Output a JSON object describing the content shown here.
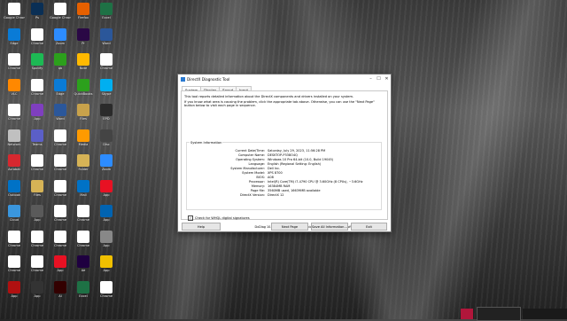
{
  "desktop": {
    "icons": [
      {
        "label": "Google Chrome",
        "color": "#ffffff"
      },
      {
        "label": "Ps",
        "color": "#0a2f55"
      },
      {
        "label": "Google Chrome",
        "color": "#ffffff"
      },
      {
        "label": "Firefox",
        "color": "#e66000"
      },
      {
        "label": "Excel",
        "color": "#1e7145"
      },
      {
        "label": "Edge",
        "color": "#0a7bd6"
      },
      {
        "label": "Chrome",
        "color": "#ffffff"
      },
      {
        "label": "Zoom",
        "color": "#2d8cff"
      },
      {
        "label": "Pr",
        "color": "#2a0845"
      },
      {
        "label": "Word",
        "color": "#2b579a"
      },
      {
        "label": "Chrome",
        "color": "#ffffff"
      },
      {
        "label": "Spotify",
        "color": "#1db954"
      },
      {
        "label": "qb",
        "color": "#2ca01c"
      },
      {
        "label": "Note",
        "color": "#ffb900"
      },
      {
        "label": "Chrome",
        "color": "#ffffff"
      },
      {
        "label": "VLC",
        "color": "#ff8800"
      },
      {
        "label": "Chrome",
        "color": "#ffffff"
      },
      {
        "label": "Edge",
        "color": "#0a7bd6"
      },
      {
        "label": "QuickBooks",
        "color": "#2ca01c"
      },
      {
        "label": "Skype",
        "color": "#00aff0"
      },
      {
        "label": "Chrome",
        "color": "#ffffff"
      },
      {
        "label": "App",
        "color": "#7f3fbf"
      },
      {
        "label": "Word",
        "color": "#2b579a"
      },
      {
        "label": "Files",
        "color": "#c8a24b"
      },
      {
        "label": "EPD",
        "color": "#2b2b2b"
      },
      {
        "label": "Network",
        "color": "#c0c0c0"
      },
      {
        "label": "Teams",
        "color": "#5b5fc7"
      },
      {
        "label": "Chrome",
        "color": "#ffffff"
      },
      {
        "label": "Media",
        "color": "#ff9a00"
      },
      {
        "label": "Disc",
        "color": "#444444"
      },
      {
        "label": "Acrobat",
        "color": "#d7282f"
      },
      {
        "label": "Chrome",
        "color": "#ffffff"
      },
      {
        "label": "Chrome",
        "color": "#ffffff"
      },
      {
        "label": "Folder",
        "color": "#d6b356"
      },
      {
        "label": "Zoom",
        "color": "#2d8cff"
      },
      {
        "label": "Outlook",
        "color": "#0072c6"
      },
      {
        "label": "Files",
        "color": "#d6b356"
      },
      {
        "label": "Chrome",
        "color": "#ffffff"
      },
      {
        "label": "Mail",
        "color": "#0072c6"
      },
      {
        "label": "App",
        "color": "#e81123"
      },
      {
        "label": "Cloud",
        "color": "#3a96dd"
      },
      {
        "label": "App",
        "color": "#5a5a5a"
      },
      {
        "label": "Chrome",
        "color": "#ffffff"
      },
      {
        "label": "Chrome",
        "color": "#ffffff"
      },
      {
        "label": "App",
        "color": "#0063b1"
      },
      {
        "label": "Chrome",
        "color": "#ffffff"
      },
      {
        "label": "Chrome",
        "color": "#ffffff"
      },
      {
        "label": "Chrome",
        "color": "#ffffff"
      },
      {
        "label": "Chrome",
        "color": "#ffffff"
      },
      {
        "label": "App",
        "color": "#888888"
      },
      {
        "label": "Chrome",
        "color": "#ffffff"
      },
      {
        "label": "Chrome",
        "color": "#ffffff"
      },
      {
        "label": "App",
        "color": "#e81123"
      },
      {
        "label": "Ae",
        "color": "#1f0040"
      },
      {
        "label": "App",
        "color": "#f0c000"
      },
      {
        "label": "App",
        "color": "#b01010"
      },
      {
        "label": "App",
        "color": "#333333"
      },
      {
        "label": "Ai",
        "color": "#330000"
      },
      {
        "label": "Excel",
        "color": "#1e7145"
      },
      {
        "label": "Chrome",
        "color": "#ffffff"
      },
      {
        "label": "App",
        "color": "#884488"
      },
      {
        "label": "App",
        "color": "#dddddd"
      }
    ]
  },
  "dialog": {
    "title": "DirectX Diagnostic Tool",
    "minimize": "–",
    "maximize": "☐",
    "close": "✕",
    "tabs": [
      "System",
      "Display",
      "Sound",
      "Input"
    ],
    "intro_1": "This tool reports detailed information about the DirectX components and drivers installed on your system.",
    "intro_2": "If you know what area is causing the problem, click the appropriate tab above. Otherwise, you can use the \"Next Page\" button below to visit each page in sequence.",
    "group_label": "System Information",
    "rows": [
      {
        "k": "Current Date/Time:",
        "v": "Saturday, July 29, 2023, 11:56:28 PM"
      },
      {
        "k": "Computer Name:",
        "v": "DESKTOP-P338O4Q"
      },
      {
        "k": "Operating System:",
        "v": "Windows 10 Pro 64-bit (10.0, Build 19045)"
      },
      {
        "k": "Language:",
        "v": "English (Regional Setting: English)"
      },
      {
        "k": "System Manufacturer:",
        "v": "Dell Inc."
      },
      {
        "k": "System Model:",
        "v": "XPS 8700"
      },
      {
        "k": "BIOS:",
        "v": "A08"
      },
      {
        "k": "Processor:",
        "v": "Intel(R) Core(TM) i7-4790 CPU @ 3.60GHz (8 CPUs), ~3.6GHz"
      },
      {
        "k": "Memory:",
        "v": "16384MB RAM"
      },
      {
        "k": "Page file:",
        "v": "3560MB used, 16639MB available"
      },
      {
        "k": "DirectX Version:",
        "v": "DirectX 12"
      }
    ],
    "whql_label": "Check for WHQL digital signatures",
    "whql_checked": "✓",
    "copyright": "DxDiag 10.00.19041.3570 64-bit Unicode  Copyright © Microsoft. All rights reserved.",
    "buttons": {
      "help": "Help",
      "next": "Next Page",
      "save": "Save All Information...",
      "exit": "Exit"
    }
  }
}
